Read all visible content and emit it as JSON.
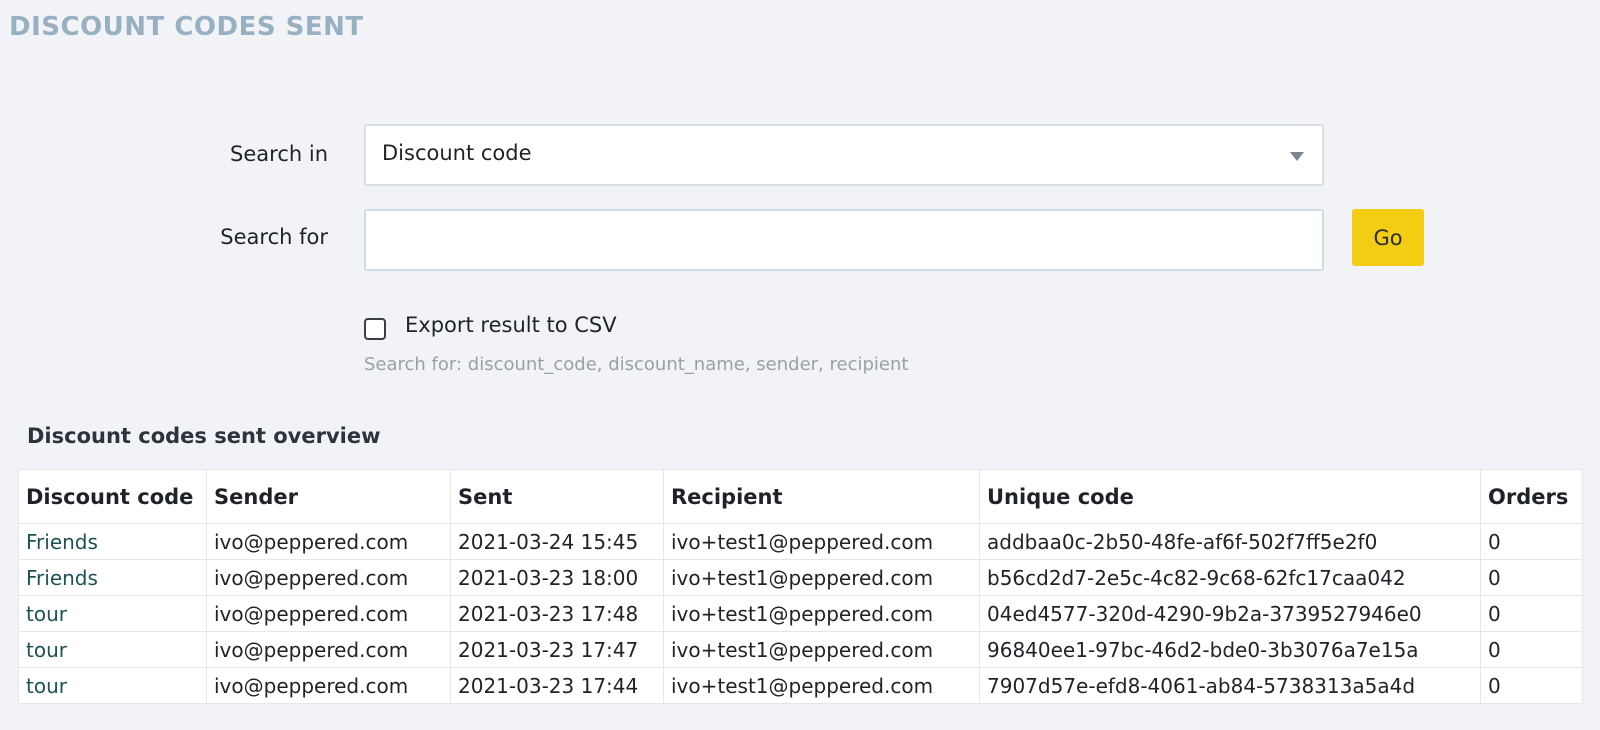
{
  "page": {
    "title": "DISCOUNT CODES SENT"
  },
  "search_form": {
    "search_in_label": "Search in",
    "search_in_value": "Discount code",
    "search_for_label": "Search for",
    "search_for_value": "",
    "go_label": "Go",
    "export_label": "Export result to CSV",
    "export_checked": false,
    "hint": "Search for: discount_code, discount_name, sender, recipient"
  },
  "overview": {
    "title": "Discount codes sent overview",
    "columns": [
      "Discount code",
      "Sender",
      "Sent",
      "Recipient",
      "Unique code",
      "Orders"
    ],
    "rows": [
      [
        "Friends",
        "ivo@peppered.com",
        "2021-03-24 15:45",
        "ivo+test1@peppered.com",
        "addbaa0c-2b50-48fe-af6f-502f7ff5e2f0",
        "0"
      ],
      [
        "Friends",
        "ivo@peppered.com",
        "2021-03-23 18:00",
        "ivo+test1@peppered.com",
        "b56cd2d7-2e5c-4c82-9c68-62fc17caa042",
        "0"
      ],
      [
        "tour",
        "ivo@peppered.com",
        "2021-03-23 17:48",
        "ivo+test1@peppered.com",
        "04ed4577-320d-4290-9b2a-3739527946e0",
        "0"
      ],
      [
        "tour",
        "ivo@peppered.com",
        "2021-03-23 17:47",
        "ivo+test1@peppered.com",
        "96840ee1-97bc-46d2-bde0-3b3076a7e15a",
        "0"
      ],
      [
        "tour",
        "ivo@peppered.com",
        "2021-03-23 17:44",
        "ivo+test1@peppered.com",
        "7907d57e-efd8-4061-ab84-5738313a5a4d",
        "0"
      ]
    ]
  }
}
